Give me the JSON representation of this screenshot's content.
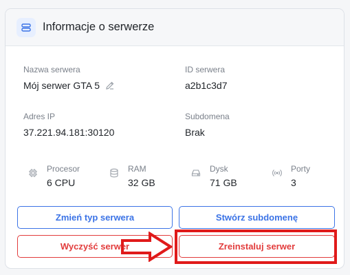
{
  "card": {
    "title": "Informacje o serwerze",
    "icon": "server-icon"
  },
  "details": {
    "server_name": {
      "label": "Nazwa serwera",
      "value": "Mój serwer GTA 5"
    },
    "server_id": {
      "label": "ID serwera",
      "value": "a2b1c3d7"
    },
    "ip_address": {
      "label": "Adres IP",
      "value": "37.221.94.181:30120"
    },
    "subdomain": {
      "label": "Subdomena",
      "value": "Brak"
    }
  },
  "specs": {
    "cpu": {
      "label": "Procesor",
      "value": "6 CPU",
      "icon": "cpu-icon"
    },
    "ram": {
      "label": "RAM",
      "value": "32 GB",
      "icon": "database-icon"
    },
    "disk": {
      "label": "Dysk",
      "value": "71 GB",
      "icon": "hard-drive-icon"
    },
    "ports": {
      "label": "Porty",
      "value": "3",
      "icon": "broadcast-icon"
    }
  },
  "actions": {
    "change_type": "Zmień typ serwera",
    "create_subdomain": "Stwórz subdomenę",
    "wipe": "Wyczyść serwer",
    "reinstall": "Zreinstaluj serwer"
  },
  "colors": {
    "primary": "#3b73e6",
    "danger": "#e23c3c",
    "annotation": "#e01a1a"
  }
}
